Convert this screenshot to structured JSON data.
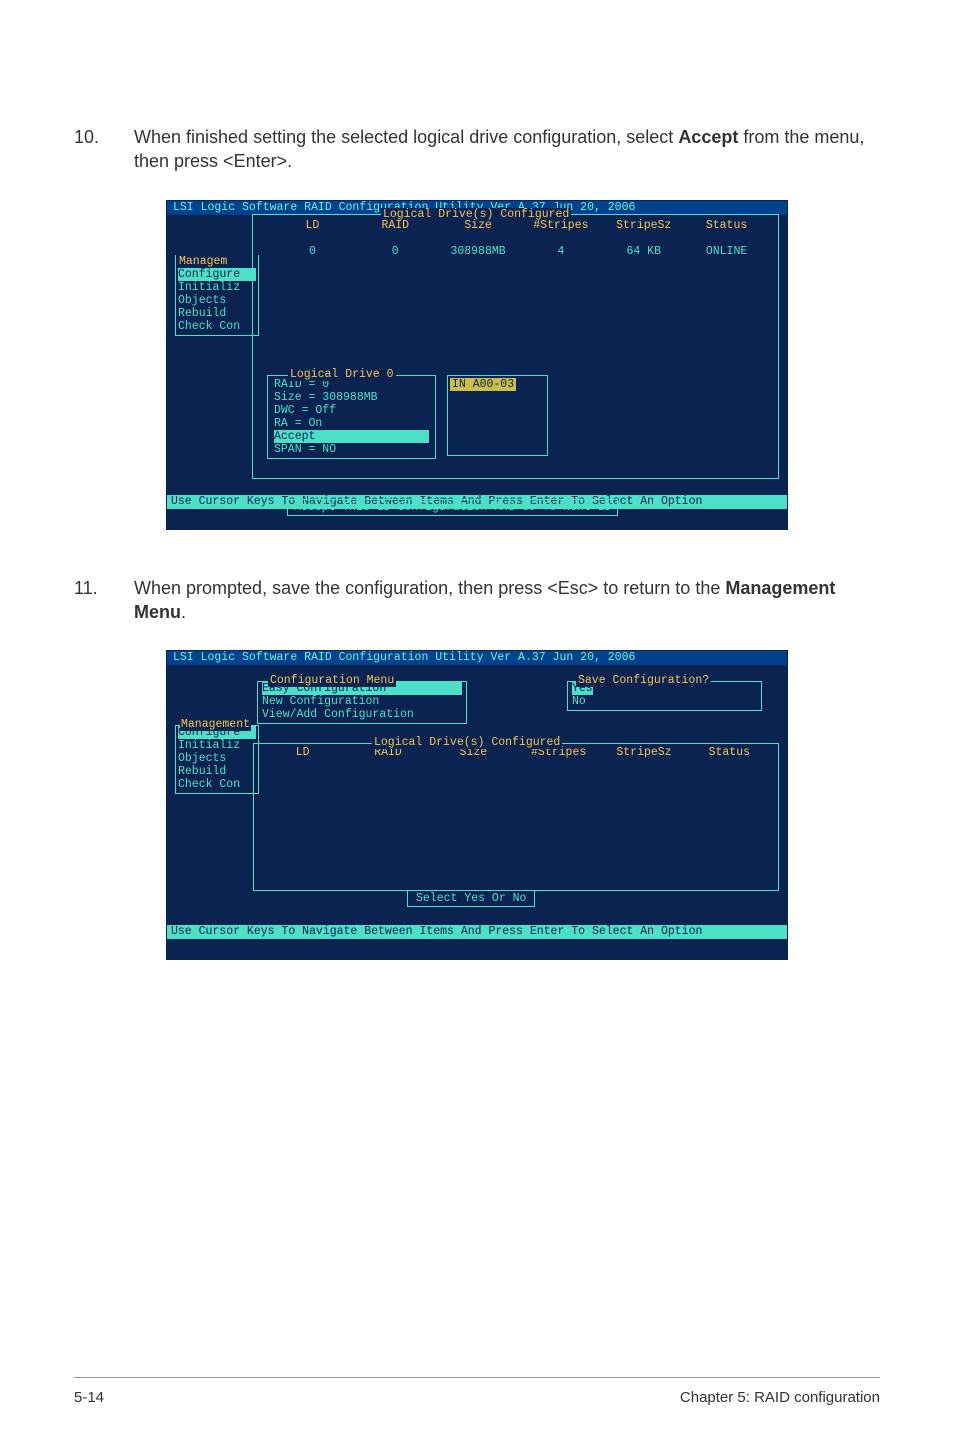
{
  "steps": {
    "10": {
      "num": "10.",
      "text_before": "When finished setting the selected logical drive configuration, select ",
      "bold1": "Accept",
      "text_after": " from the menu, then press <Enter>."
    },
    "11": {
      "num": "11.",
      "text_before": "When prompted, save the configuration, then press <Esc> to return to the ",
      "bold1": "Management Menu",
      "text_after": "."
    }
  },
  "term": {
    "titlebar": "LSI Logic Software RAID Configuration Utility Ver A.37 Jun 20, 2006",
    "footbar": "Use Cursor Keys To Navigate Between Items And Press Enter To Select An Option"
  },
  "t1": {
    "ldConfiguredTitle": "Logical Drive(s) Configured",
    "cols": {
      "ld": "LD",
      "raid": "RAID",
      "size": "Size",
      "stripes": "#Stripes",
      "stripesz": "StripeSz",
      "status": "Status"
    },
    "row": {
      "ld": "0",
      "raid": "0",
      "size": "308988MB",
      "stripes": "4",
      "stripesz": "64  KB",
      "status": "ONLINE"
    },
    "sidebar": {
      "title": "Managem",
      "items": [
        "Configure",
        "Initializ",
        "Objects",
        "Rebuild",
        "Check Con"
      ],
      "hlIndex": 0
    },
    "ldbox": {
      "title": "Logical Drive 0",
      "lines": [
        "RAID = 0",
        "Size = 308988MB",
        "DWC  = Off",
        "RA   = On",
        "Accept",
        "SPAN = NO"
      ],
      "hlIndex": 4
    },
    "port": "IN A00-03",
    "accept": "Accept This LD Configuration And Go To Next LD"
  },
  "t2": {
    "mgmt": {
      "title": "Management",
      "items": [
        "Configure",
        "Initializ",
        "Objects",
        "Rebuild",
        "Check Con"
      ],
      "hlIndex": 0
    },
    "cfg": {
      "title": "Configuration Menu",
      "items": [
        "Easy Configuration",
        "New Configuration",
        "View/Add Configuration"
      ],
      "hlIndex": 0
    },
    "save": {
      "title": "Save Configuration?",
      "items": [
        "Yes",
        "No"
      ],
      "hlIndex": 0
    },
    "ld": {
      "title": "Logical Drive(s) Configured",
      "cols": {
        "ld": "LD",
        "raid": "RAID",
        "size": "Size",
        "stripes": "#Stripes",
        "stripesz": "StripeSz",
        "status": "Status"
      }
    },
    "sel": "Select Yes Or No"
  },
  "footer": {
    "left": "5-14",
    "right": "Chapter 5: RAID configuration"
  }
}
